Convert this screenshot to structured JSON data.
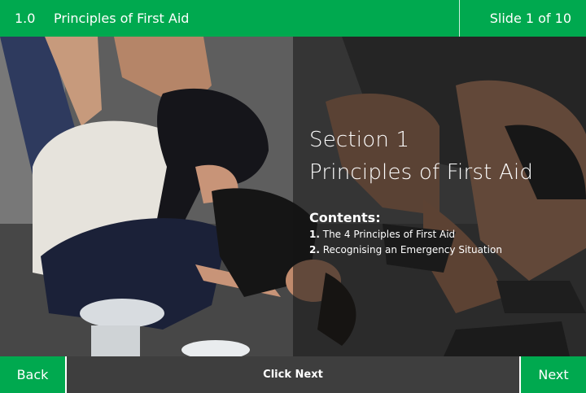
{
  "header": {
    "section_number": "1.0",
    "title": "Principles of First Aid",
    "slide_counter": "Slide 1 of 10"
  },
  "content": {
    "section_label": "Section 1",
    "section_title": "Principles of First Aid",
    "contents_heading": "Contents:",
    "items": [
      {
        "number": "1.",
        "text": "The 4 Principles of First Aid"
      },
      {
        "number": "2.",
        "text": "Recognising an Emergency Situation"
      }
    ]
  },
  "footer": {
    "back_label": "Back",
    "prompt": "Click Next",
    "next_label": "Next"
  },
  "colors": {
    "accent": "#00a94f",
    "footer_bar": "#3e3e3e"
  }
}
